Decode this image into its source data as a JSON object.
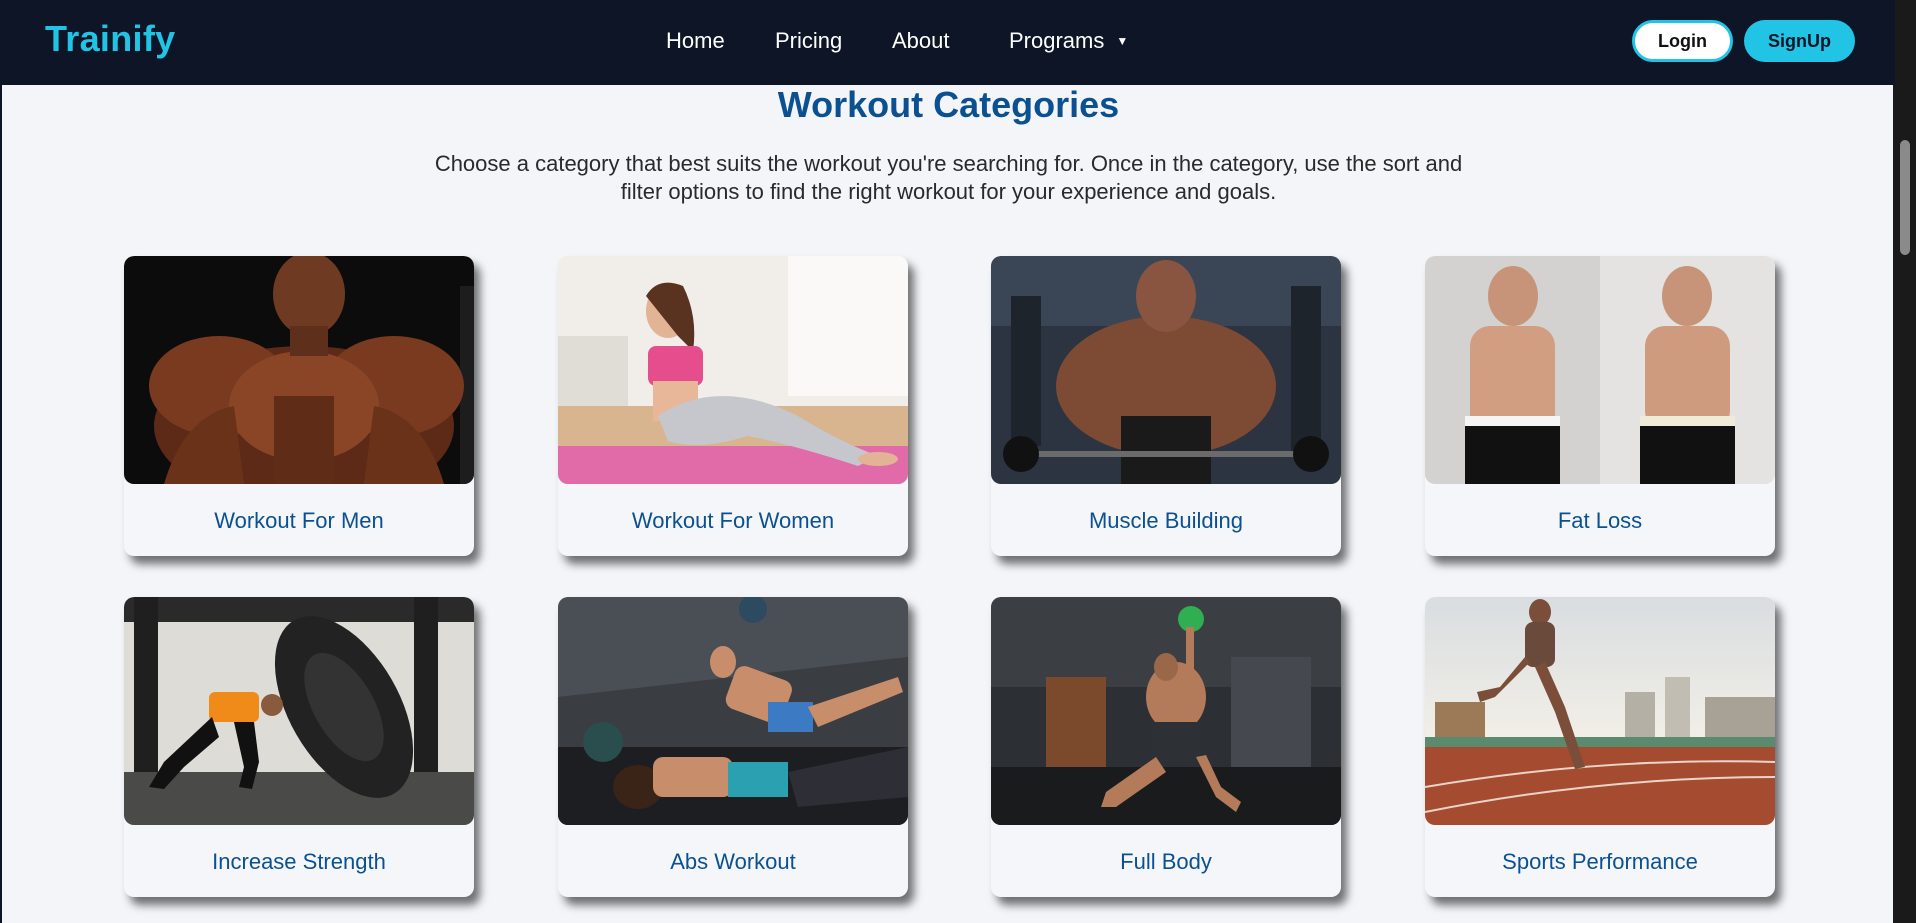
{
  "nav": {
    "brand": "Trainify",
    "links": [
      {
        "label": "Home"
      },
      {
        "label": "Pricing"
      },
      {
        "label": "About"
      },
      {
        "label": "Programs",
        "icon": "caret-down-icon"
      }
    ],
    "login_label": "Login",
    "signup_label": "SignUp"
  },
  "section": {
    "title": "Workout Categories",
    "description": "Choose a category that best suits the workout you're searching for. Once in the category, use the sort and filter options to find the right workout for your experience and goals."
  },
  "categories": [
    {
      "label": "Workout For Men"
    },
    {
      "label": "Workout For Women"
    },
    {
      "label": "Muscle Building"
    },
    {
      "label": "Fat Loss"
    },
    {
      "label": "Increase Strength"
    },
    {
      "label": "Abs Workout"
    },
    {
      "label": "Full Body"
    },
    {
      "label": "Sports Performance"
    }
  ],
  "colors": {
    "navbar_bg": "#0d1526",
    "brand": "#22c4e6",
    "accent": "#22c4e6",
    "title": "#0b5191",
    "page_bg": "#f3f5f9"
  }
}
